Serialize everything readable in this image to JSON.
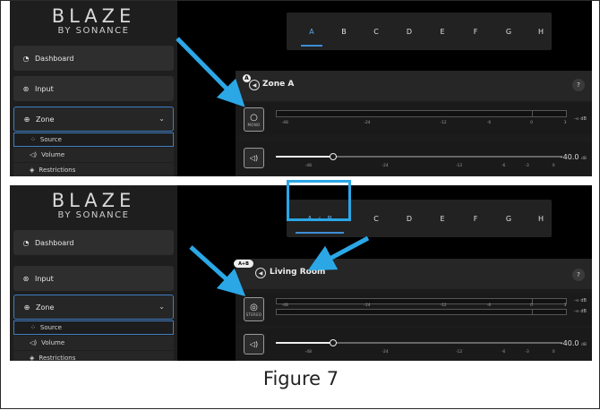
{
  "brand": {
    "name": "BLAZE",
    "sub": "BY SONANCE"
  },
  "sidebar": {
    "dashboard": "Dashboard",
    "input": "Input",
    "zone": "Zone",
    "source": "Source",
    "volume": "Volume",
    "restrictions": "Restrictions"
  },
  "panel1": {
    "tabs": [
      "A",
      "B",
      "C",
      "D",
      "E",
      "F",
      "G",
      "H"
    ],
    "active_tab": "A",
    "zone_letter": "A",
    "zone_title": "Zone A",
    "mode_label": "MONO",
    "help": "?",
    "meter_labels": [
      "-48",
      "-24",
      "-12",
      "-6",
      "0",
      "3"
    ],
    "meter_db": "-∞ dB",
    "slider_labels": [
      "-48",
      "-24",
      "-12",
      "-6",
      "-3",
      "0"
    ],
    "volume_value": "-40.0",
    "volume_unit": "dB",
    "volume_level_fraction": 0.2
  },
  "panel2": {
    "tab_a": "A",
    "tab_plus": "+",
    "tab_b": "B",
    "tabs_rest": [
      "C",
      "D",
      "E",
      "F",
      "G",
      "H"
    ],
    "zone_letter": "A+B",
    "zone_title": "Living Room",
    "mode_label": "STEREO",
    "help": "?",
    "meter_labels": [
      "-48",
      "-24",
      "-12",
      "-6",
      "0",
      "3"
    ],
    "meter_db_1": "-∞ dB",
    "meter_db_2": "-∞ dB",
    "slider_labels": [
      "-48",
      "-24",
      "-12",
      "-6",
      "-3",
      "0"
    ],
    "volume_value": "-40.0",
    "volume_unit": "dB",
    "volume_level_fraction": 0.2
  },
  "caption": "Figure 7",
  "colors": {
    "accent": "#3d8ed8",
    "annotation": "#2ba7e6",
    "background": "#000000"
  },
  "icons": {
    "dashboard": "dashboard-gauge-icon",
    "input": "input-icon",
    "zone": "speaker-icon",
    "source": "source-arrows-icon",
    "volume": "volume-icon",
    "restrictions": "restrictions-icon"
  }
}
